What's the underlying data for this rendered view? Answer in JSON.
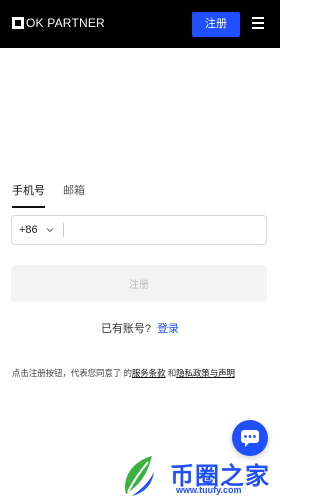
{
  "header": {
    "logo_text": "OK PARTNER",
    "register_label": "注册",
    "menu_icon": "hamburger-menu-icon"
  },
  "form": {
    "tabs": [
      {
        "label": "手机号",
        "active": true
      },
      {
        "label": "邮箱",
        "active": false
      }
    ],
    "country_code": "+86",
    "phone_value": "",
    "submit_label": "注册"
  },
  "login": {
    "prompt": "已有账号?",
    "link_label": "登录"
  },
  "terms": {
    "prefix": "点击注册按钮，代表您同意了 的",
    "service_link": "服务条款",
    "and": " 和",
    "privacy_link": "隐私政策与声明"
  },
  "chat": {
    "icon": "chat-bubble-icon"
  },
  "watermark": {
    "text": "币圈之家",
    "url": "www.tuufy.com"
  },
  "colors": {
    "accent": "#1f4fff",
    "header_bg": "#000000",
    "disabled_bg": "#f3f3f3"
  }
}
